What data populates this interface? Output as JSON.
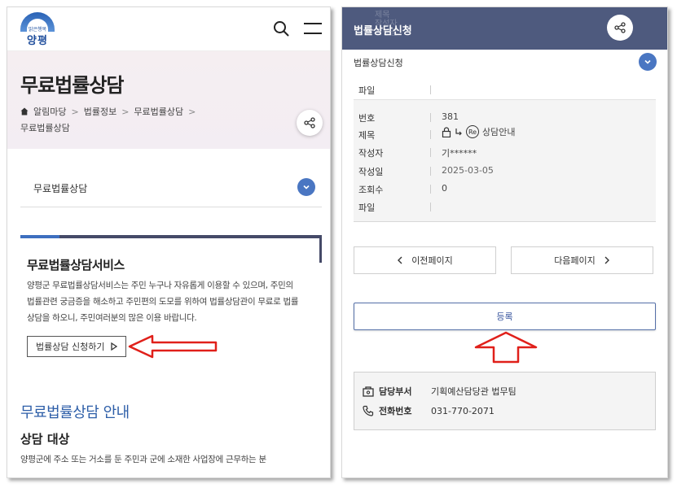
{
  "left": {
    "logo": {
      "small": "맑은행복",
      "text": "양평"
    },
    "title": "무료법률상담",
    "breadcrumb": {
      "home": "알림마당",
      "item2": "법률정보",
      "item3": "무료법률상담",
      "item4": "무료법률상담",
      "sep": ">"
    },
    "select_label": "무료법률상담",
    "service": {
      "title": "무료법률상담서비스",
      "desc_line1": "양평군 무료법률상담서비스는 주민 누구나 자유롭게 이용할 수 있으며, 주민의",
      "desc_line2": "법률관련 궁금증을 해소하고 주민편의 도모를 위하여 법률상담관이 무료로 법률",
      "desc_line3": "상담을 하오니, 주민여러분의 많은 이용 바랍니다.",
      "apply_button": "법률상담 신청하기"
    },
    "guide": {
      "title": "무료법률상담 안내",
      "subtitle": "상담 대상",
      "desc": "양평군에 주소 또는 거소를 둔 주민과 군에 소재한 사업장에 근무하는 분"
    }
  },
  "right": {
    "ghost_text": {
      "line1": "제목",
      "line2": "작성자",
      "line3": "작성일"
    },
    "header_title": "법률상담신청",
    "select_label": "법률상담신청",
    "file_top_label": "파일",
    "info": {
      "number_label": "번호",
      "number_value": "381",
      "title_label": "제목",
      "re_badge": "Re",
      "title_value": "상담안내",
      "author_label": "작성자",
      "author_value": "기******",
      "date_label": "작성일",
      "date_value": "2025-03-05",
      "views_label": "조회수",
      "views_value": "0",
      "file_label": "파일"
    },
    "prev_button": "이전페이지",
    "next_button": "다음페이지",
    "register_button": "등록",
    "contact": {
      "dept_label": "담당부서",
      "dept_value": "기획예산담당관 법무팀",
      "phone_label": "전화번호",
      "phone_value": "031-770-2071"
    }
  },
  "colors": {
    "accent_blue": "#4a76c2",
    "header_navy": "#4e5a7e",
    "arrow_red": "#e0201a"
  }
}
